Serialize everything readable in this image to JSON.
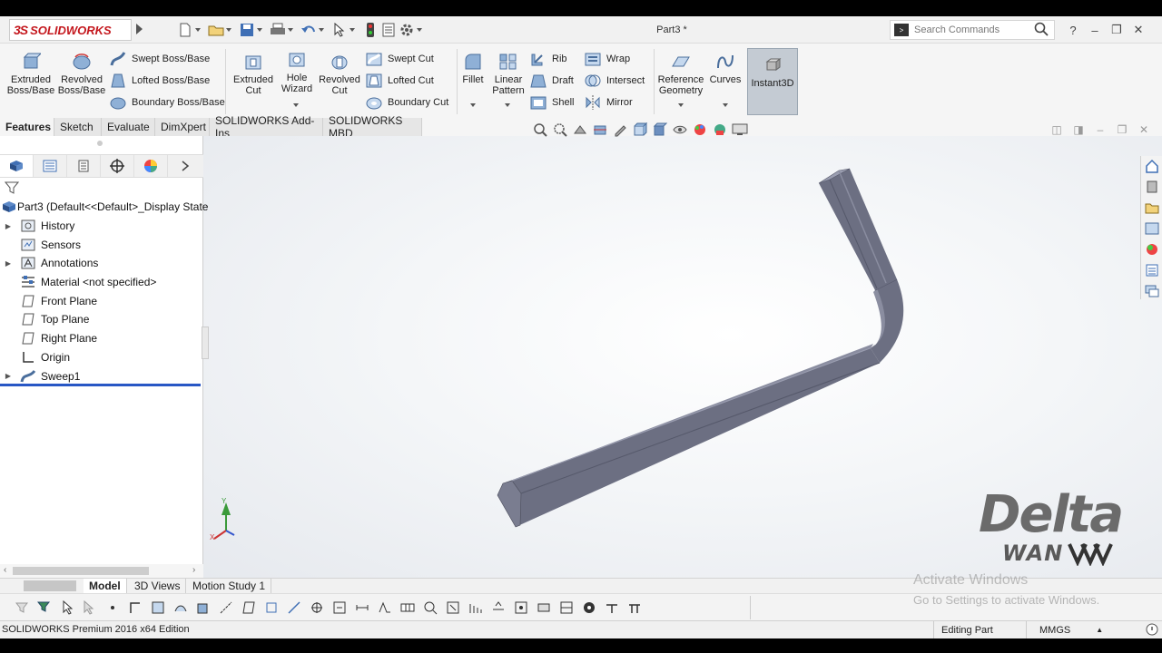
{
  "titlebar": {
    "brand": "SOLIDWORKS",
    "document_title": "Part3 *",
    "search_placeholder": "Search Commands",
    "help_label": "?"
  },
  "command_manager": {
    "big_buttons": [
      {
        "label": "Extruded Boss/Base",
        "icon": "extruded-boss-icon"
      },
      {
        "label": "Revolved Boss/Base",
        "icon": "revolved-boss-icon"
      },
      {
        "label": "Extruded Cut",
        "icon": "extruded-cut-icon"
      },
      {
        "label": "Hole Wizard",
        "icon": "hole-wizard-icon"
      },
      {
        "label": "Revolved Cut",
        "icon": "revolved-cut-icon"
      },
      {
        "label": "Fillet",
        "icon": "fillet-icon"
      },
      {
        "label": "Linear Pattern",
        "icon": "linear-pattern-icon"
      },
      {
        "label": "Reference Geometry",
        "icon": "reference-geometry-icon"
      },
      {
        "label": "Curves",
        "icon": "curves-icon"
      },
      {
        "label": "Instant3D",
        "icon": "instant3d-icon"
      }
    ],
    "small_buttons": {
      "swept_boss": "Swept Boss/Base",
      "lofted_boss": "Lofted Boss/Base",
      "boundary_boss": "Boundary Boss/Base",
      "swept_cut": "Swept Cut",
      "lofted_cut": "Lofted Cut",
      "boundary_cut": "Boundary Cut",
      "rib": "Rib",
      "draft": "Draft",
      "shell": "Shell",
      "wrap": "Wrap",
      "intersect": "Intersect",
      "mirror": "Mirror"
    },
    "tabs": [
      "Features",
      "Sketch",
      "Evaluate",
      "DimXpert",
      "SOLIDWORKS Add-Ins",
      "SOLIDWORKS MBD"
    ],
    "active_tab": "Features"
  },
  "feature_tree": {
    "root": "Part3  (Default<<Default>_Display State",
    "items": [
      {
        "label": "History",
        "icon": "history-folder-icon",
        "expandable": true
      },
      {
        "label": "Sensors",
        "icon": "sensors-icon",
        "expandable": false
      },
      {
        "label": "Annotations",
        "icon": "annotations-icon",
        "expandable": true
      },
      {
        "label": "Material <not specified>",
        "icon": "material-icon",
        "expandable": false
      },
      {
        "label": "Front Plane",
        "icon": "plane-icon",
        "expandable": false
      },
      {
        "label": "Top Plane",
        "icon": "plane-icon",
        "expandable": false
      },
      {
        "label": "Right Plane",
        "icon": "plane-icon",
        "expandable": false
      },
      {
        "label": "Origin",
        "icon": "origin-icon",
        "expandable": false
      },
      {
        "label": "Sweep1",
        "icon": "sweep-icon",
        "expandable": true
      }
    ]
  },
  "triad": {
    "y": "Y",
    "x": "X"
  },
  "bottom_tabs": [
    "Model",
    "3D Views",
    "Motion Study 1"
  ],
  "active_bottom_tab": "Model",
  "status": {
    "edition": "SOLIDWORKS Premium 2016 x64 Edition",
    "mode": "Editing Part",
    "units": "MMGS"
  },
  "watermark": {
    "brand_line1": "Delta",
    "brand_line2": "WAN",
    "activate_title": "Activate Windows",
    "activate_sub": "Go to Settings to activate Windows."
  },
  "colors": {
    "model_face": "#6c6f82",
    "model_top": "#8a8da0",
    "accent_red": "#c4171d",
    "rollback_bar": "#2857c5"
  }
}
